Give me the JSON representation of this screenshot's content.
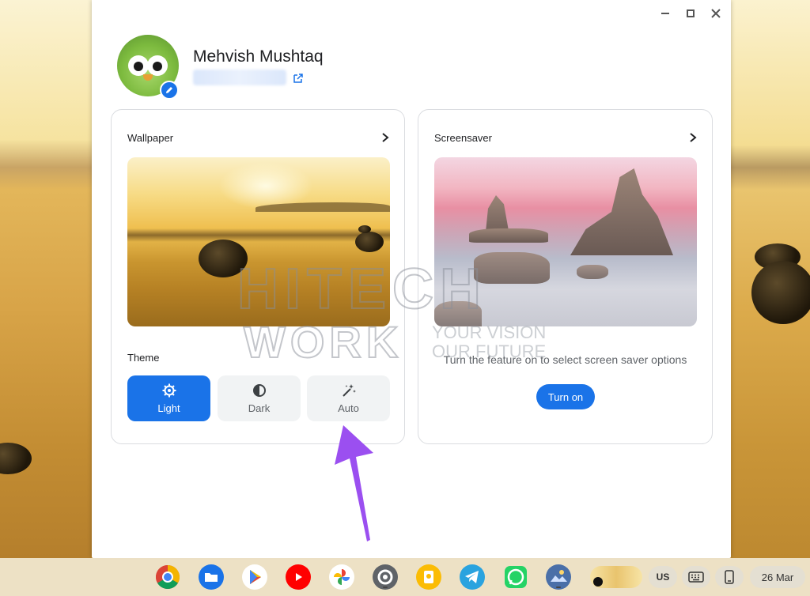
{
  "window": {
    "controls": [
      "minimize",
      "maximize",
      "close"
    ]
  },
  "profile": {
    "name": "Mehvish Mushtaq",
    "email_blurred": ""
  },
  "wallpaper_card": {
    "title": "Wallpaper"
  },
  "theme": {
    "label": "Theme",
    "options": [
      {
        "label": "Light",
        "icon": "gear-icon",
        "selected": true
      },
      {
        "label": "Dark",
        "icon": "half-circle-icon",
        "selected": false
      },
      {
        "label": "Auto",
        "icon": "magic-wand-icon",
        "selected": false
      }
    ]
  },
  "screensaver_card": {
    "title": "Screensaver",
    "message": "Turn the feature on to select screen saver options",
    "button_label": "Turn on"
  },
  "watermark": {
    "line1": "HITECH",
    "line2": "WORK",
    "tagline1": "YOUR VISION",
    "tagline2": "OUR FUTURE"
  },
  "shelf": {
    "apps": [
      "Chrome",
      "Files",
      "Play Store",
      "YouTube",
      "Photos",
      "Settings",
      "Keep",
      "Telegram",
      "WhatsApp",
      "Wallpaper"
    ],
    "ime": "US",
    "date": "26 Mar"
  },
  "colors": {
    "accent": "#1a73e8",
    "arrow": "#9b4ff0"
  }
}
